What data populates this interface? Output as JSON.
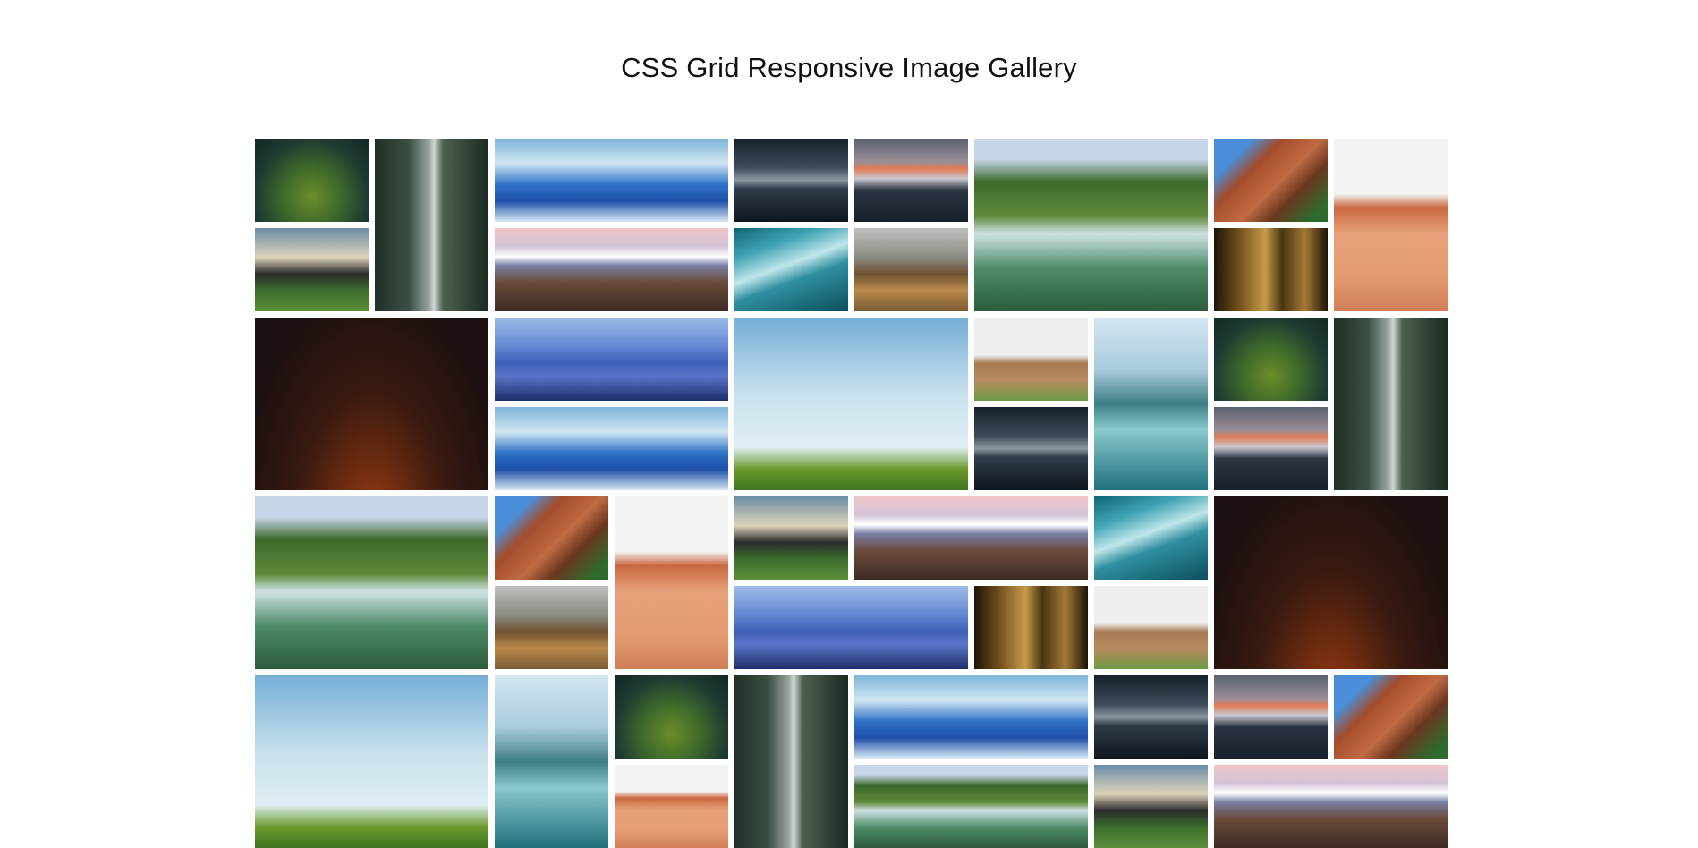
{
  "page": {
    "title": "CSS Grid Responsive Image Gallery"
  },
  "gallery": {
    "images": [
      {
        "scene": "moss",
        "layout": "small"
      },
      {
        "scene": "waterfall",
        "layout": "tall"
      },
      {
        "scene": "clouds",
        "layout": "wide"
      },
      {
        "scene": "lake-dark",
        "layout": "small"
      },
      {
        "scene": "peak",
        "layout": "small"
      },
      {
        "scene": "falls-green",
        "layout": "big"
      },
      {
        "scene": "redrock",
        "layout": "small"
      },
      {
        "scene": "desert",
        "layout": "tall"
      },
      {
        "scene": "rocks",
        "layout": "small"
      },
      {
        "scene": "ridges",
        "layout": "wide"
      },
      {
        "scene": "river",
        "layout": "small"
      },
      {
        "scene": "hill",
        "layout": "small"
      },
      {
        "scene": "forest",
        "layout": "small"
      },
      {
        "scene": "night",
        "layout": "big"
      },
      {
        "scene": "blue-mtn",
        "layout": "wide"
      },
      {
        "scene": "tree",
        "layout": "big"
      },
      {
        "scene": "field",
        "layout": "small"
      },
      {
        "scene": "fjord",
        "layout": "tall"
      },
      {
        "scene": "moss",
        "layout": "small"
      },
      {
        "scene": "waterfall",
        "layout": "tall"
      },
      {
        "scene": "clouds",
        "layout": "wide"
      },
      {
        "scene": "lake-dark",
        "layout": "small"
      },
      {
        "scene": "peak",
        "layout": "small"
      },
      {
        "scene": "falls-green",
        "layout": "big"
      },
      {
        "scene": "redrock",
        "layout": "small"
      },
      {
        "scene": "desert",
        "layout": "tall"
      },
      {
        "scene": "rocks",
        "layout": "small"
      },
      {
        "scene": "ridges",
        "layout": "wide"
      },
      {
        "scene": "river",
        "layout": "small"
      },
      {
        "scene": "night",
        "layout": "big"
      },
      {
        "scene": "hill",
        "layout": "small"
      },
      {
        "scene": "blue-mtn",
        "layout": "wide"
      },
      {
        "scene": "forest",
        "layout": "small"
      },
      {
        "scene": "field",
        "layout": "small"
      },
      {
        "scene": "tree",
        "layout": "big"
      },
      {
        "scene": "fjord",
        "layout": "tall"
      },
      {
        "scene": "moss",
        "layout": "small"
      },
      {
        "scene": "waterfall",
        "layout": "tall"
      },
      {
        "scene": "clouds",
        "layout": "wide"
      },
      {
        "scene": "lake-dark",
        "layout": "small"
      },
      {
        "scene": "peak",
        "layout": "small"
      },
      {
        "scene": "redrock",
        "layout": "small"
      },
      {
        "scene": "desert",
        "layout": "small"
      },
      {
        "scene": "falls-green",
        "layout": "wide"
      },
      {
        "scene": "rocks",
        "layout": "small"
      },
      {
        "scene": "ridges",
        "layout": "wide"
      }
    ]
  }
}
